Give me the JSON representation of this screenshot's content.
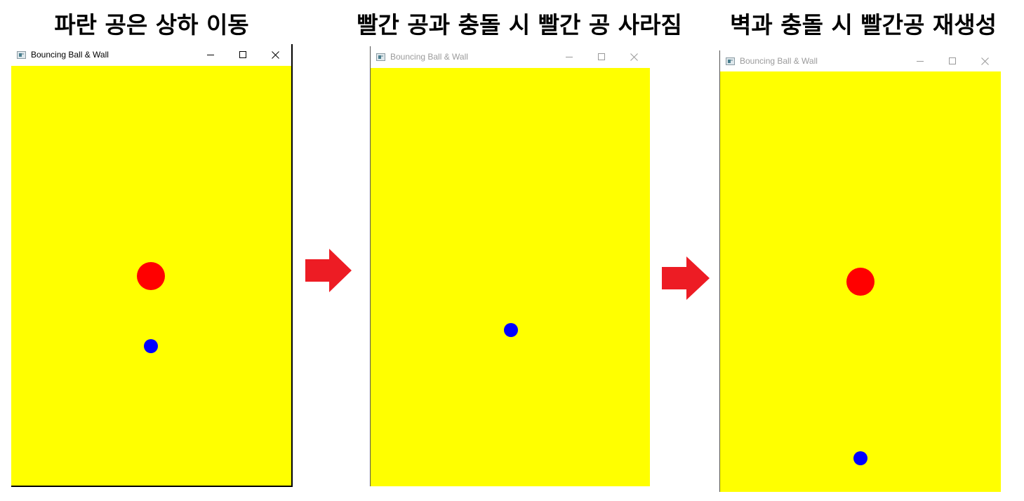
{
  "panels": [
    {
      "heading": "파란 공은 상하 이동",
      "window": {
        "title": "Bouncing Ball & Wall",
        "active": true
      },
      "balls": {
        "red_visible": true,
        "blue_visible": true
      }
    },
    {
      "heading": "빨간 공과 충돌 시 빨간 공 사라짐",
      "window": {
        "title": "Bouncing Ball & Wall",
        "active": false
      },
      "balls": {
        "red_visible": false,
        "blue_visible": true
      }
    },
    {
      "heading": "벽과 충돌 시 빨간공 재생성",
      "window": {
        "title": "Bouncing Ball & Wall",
        "active": false
      },
      "balls": {
        "red_visible": true,
        "blue_visible": true
      }
    }
  ],
  "window_controls": [
    "minimize-icon",
    "maximize-icon",
    "close-icon"
  ],
  "colors": {
    "canvas": "#ffff00",
    "red_ball": "#ff0000",
    "blue_ball": "#0000ff",
    "arrow": "#ed1c24"
  }
}
